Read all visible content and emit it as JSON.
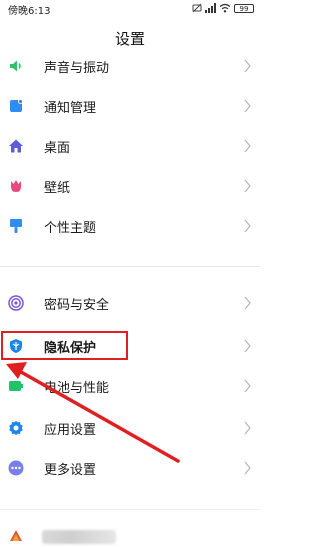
{
  "status": {
    "time": "傍晚6:13",
    "battery": "99"
  },
  "header": {
    "title": "设置"
  },
  "menu": [
    {
      "label": "声音与振动",
      "icon": "speaker-icon"
    },
    {
      "label": "通知管理",
      "icon": "notification-icon"
    },
    {
      "label": "桌面",
      "icon": "home-icon"
    },
    {
      "label": "壁纸",
      "icon": "tulip-icon"
    },
    {
      "label": "个性主题",
      "icon": "paintbrush-icon"
    },
    {
      "label": "密码与安全",
      "icon": "fingerprint-icon"
    },
    {
      "label": "隐私保护",
      "icon": "shield-icon"
    },
    {
      "label": "电池与性能",
      "icon": "battery-icon"
    },
    {
      "label": "应用设置",
      "icon": "gear-icon"
    },
    {
      "label": "更多设置",
      "icon": "more-icon"
    }
  ],
  "colors": {
    "annotation": "#e02020",
    "sound": "#2cc36b",
    "notification": "#2f8cf0",
    "home": "#5b5fd8",
    "wallpaper": "#e84a7f",
    "theme": "#2f8cf0",
    "security": "#7b55d6",
    "privacy": "#1f86e6",
    "battery": "#23c26a",
    "apps": "#1f86e6",
    "more": "#7a7fe8"
  }
}
